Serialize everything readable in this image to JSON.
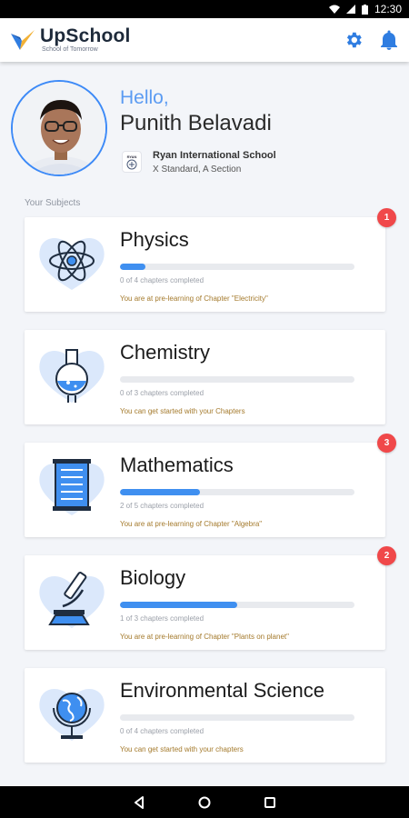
{
  "status_bar": {
    "time": "12:30"
  },
  "app": {
    "name": "UpSchool",
    "tagline": "School of Tomorrow"
  },
  "profile": {
    "greeting": "Hello,",
    "name": "Punith Belavadi",
    "school_logo_text": "RYAN",
    "school": "Ryan International School",
    "class": "X Standard, A Section"
  },
  "subjects_label": "Your Subjects",
  "subjects": [
    {
      "name": "Physics",
      "chapters": "0 of 4 chapters completed",
      "status": "You are at pre-learning of Chapter \"Electricity\"",
      "progress": 0.11,
      "badge": "1",
      "icon": "atom-icon"
    },
    {
      "name": "Chemistry",
      "chapters": "0 of 3 chapters completed",
      "status": "You can get started with your Chapters",
      "progress": 0,
      "badge": "",
      "icon": "flask-icon"
    },
    {
      "name": "Mathematics",
      "chapters": "2 of 5 chapters completed",
      "status": "You are at pre-learning of Chapter \"Algebra\"",
      "progress": 0.34,
      "badge": "3",
      "icon": "abacus-icon"
    },
    {
      "name": "Biology",
      "chapters": "1 of 3 chapters completed",
      "status": "You are at pre-learning of Chapter \"Plants on planet\"",
      "progress": 0.5,
      "badge": "2",
      "icon": "microscope-icon"
    },
    {
      "name": "Environmental Science",
      "chapters": "0 of 4 chapters completed",
      "status": "You can get started with your chapters",
      "progress": 0,
      "badge": "",
      "icon": "globe-icon"
    }
  ],
  "colors": {
    "accent": "#3f8ff0",
    "badge": "#f0484a",
    "status_text": "#a47a2c"
  }
}
